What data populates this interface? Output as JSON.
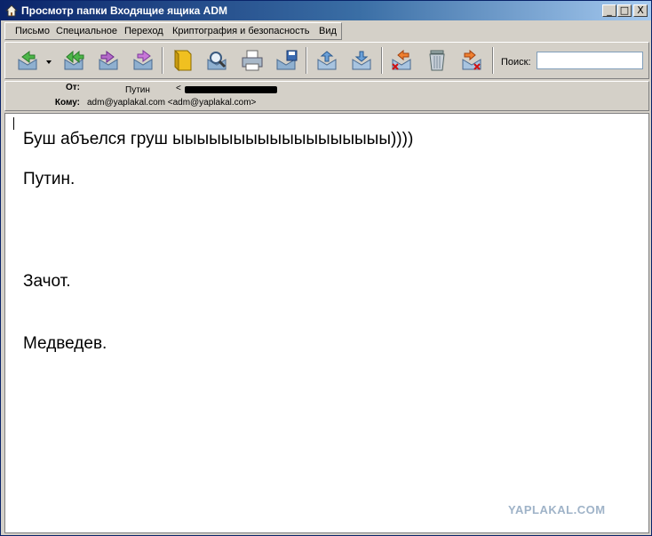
{
  "window": {
    "title": "Просмотр папки Входящие ящика ADM",
    "controls": {
      "minimize": "_",
      "maximize": "□",
      "close": "X"
    }
  },
  "menu": [
    {
      "label": "Письмо"
    },
    {
      "label": "Специальное"
    },
    {
      "label": "Переход"
    },
    {
      "label": "Криптография и безопасность"
    },
    {
      "label": "Вид"
    }
  ],
  "toolbar": {
    "buttons": [
      {
        "icon": "reply-icon"
      },
      {
        "icon": "dropdown-arrow-icon"
      },
      {
        "icon": "reply-all-icon"
      },
      {
        "icon": "forward-icon"
      },
      {
        "icon": "redirect-icon"
      },
      {
        "icon": "address-book-icon"
      },
      {
        "icon": "find-message-icon"
      },
      {
        "icon": "print-icon"
      },
      {
        "icon": "save-icon"
      },
      {
        "icon": "previous-message-icon"
      },
      {
        "icon": "next-message-icon"
      },
      {
        "icon": "delete-message-icon"
      },
      {
        "icon": "trash-icon"
      },
      {
        "icon": "delete-forward-icon"
      }
    ],
    "search_label": "Поиск:",
    "search_value": ""
  },
  "header": {
    "from_label": "От:",
    "from_value": "Путин",
    "from_bracket": "<",
    "to_label": "Кому:",
    "to_value": "adm@yaplakal.com <adm@yaplakal.com>"
  },
  "message": {
    "lines": [
      "Буш абъелся груш ыыыыыыыыыыыыыыыыыы))))",
      "Путин.",
      "Зачот.",
      "Медведев."
    ]
  },
  "watermark": "YAPLAKAL.COM",
  "colors": {
    "title_bar": "#0a246a",
    "chrome": "#d4d0c8",
    "watermark": "#9fb3c8"
  }
}
